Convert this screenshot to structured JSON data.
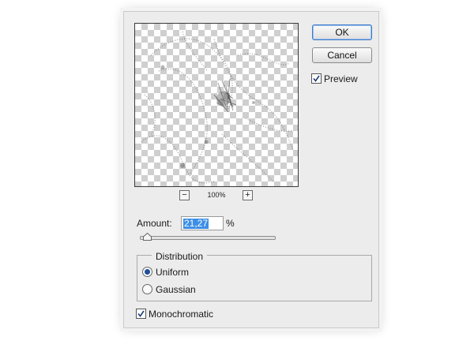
{
  "dialog": {
    "buttons": {
      "ok": "OK",
      "cancel": "Cancel"
    },
    "preview_checkbox": {
      "label": "Preview",
      "checked": true
    },
    "zoom": {
      "level": "100%",
      "out_icon": "minus-icon",
      "in_icon": "plus-icon"
    },
    "amount": {
      "label": "Amount:",
      "value": "21,27",
      "unit": "%",
      "slider_fraction": 0.05
    },
    "distribution": {
      "legend": "Distribution",
      "options": [
        {
          "label": "Uniform",
          "selected": true
        },
        {
          "label": "Gaussian",
          "selected": false
        }
      ]
    },
    "monochromatic": {
      "label": "Monochromatic",
      "checked": true
    }
  }
}
